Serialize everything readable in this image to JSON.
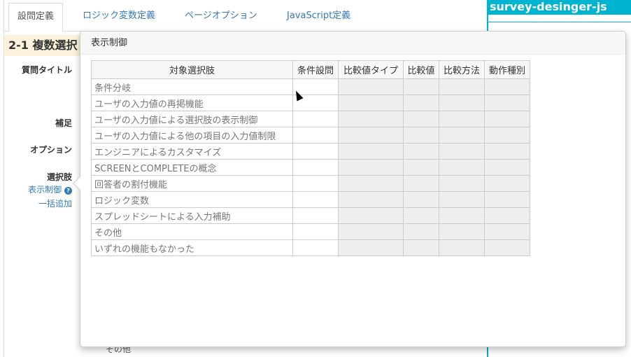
{
  "tabs": [
    {
      "label": "設問定義"
    },
    {
      "label": "ロジック変数定義"
    },
    {
      "label": "ページオプション"
    },
    {
      "label": "JavaScript定義"
    }
  ],
  "question_title": "2-1 複数選択",
  "form_labels": {
    "title": "質問タイトル",
    "note": "補足",
    "option": "オプション",
    "choices": "選択肢"
  },
  "links": {
    "visibility": "表示制御",
    "bulk_add": "一括追加"
  },
  "right_panel": {
    "title": "survey-desinger-js"
  },
  "popover": {
    "title": "表示制御",
    "columns": [
      "対象選択肢",
      "条件設問",
      "比較値タイプ",
      "比較値",
      "比較方法",
      "動作種別"
    ],
    "rows": [
      "条件分岐",
      "ユーザの入力値の再掲機能",
      "ユーザの入力値による選択肢の表示制御",
      "ユーザの入力値による他の項目の入力値制限",
      "エンジニアによるカスタマイズ",
      "SCREENとCOMPLETEの概念",
      "回答者の割付機能",
      "ロジック変数",
      "スプレッドシートによる入力補助",
      "その他",
      "いずれの機能もなかった"
    ]
  },
  "bottom_partial": "その他"
}
